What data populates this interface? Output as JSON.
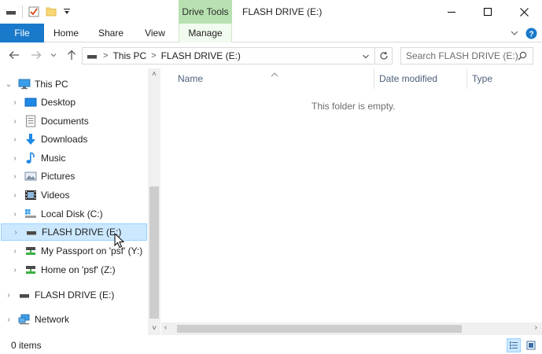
{
  "titlebar": {
    "drive_tools": "Drive Tools",
    "title": "FLASH DRIVE (E:)"
  },
  "ribbon": {
    "tabs": [
      "File",
      "Home",
      "Share",
      "View",
      "Manage"
    ]
  },
  "address": {
    "crumbs": [
      "This PC",
      "FLASH DRIVE (E:)"
    ],
    "search_placeholder": "Search FLASH DRIVE (E:)"
  },
  "nav": {
    "this_pc": "This PC",
    "items": [
      {
        "label": "Desktop",
        "icon": "desktop-icon"
      },
      {
        "label": "Documents",
        "icon": "documents-icon"
      },
      {
        "label": "Downloads",
        "icon": "downloads-icon"
      },
      {
        "label": "Music",
        "icon": "music-icon"
      },
      {
        "label": "Pictures",
        "icon": "pictures-icon"
      },
      {
        "label": "Videos",
        "icon": "videos-icon"
      },
      {
        "label": "Local Disk (C:)",
        "icon": "local-disk-icon"
      },
      {
        "label": "FLASH DRIVE (E:)",
        "icon": "usb-drive-icon"
      },
      {
        "label": "My Passport on 'psf' (Y:)",
        "icon": "network-drive-icon"
      },
      {
        "label": "Home on 'psf' (Z:)",
        "icon": "network-drive-icon"
      }
    ],
    "flash_drive": "FLASH DRIVE (E:)",
    "network": "Network"
  },
  "content": {
    "columns": [
      "Name",
      "Date modified",
      "Type"
    ],
    "empty_message": "This folder is empty."
  },
  "status": {
    "items": "0 items"
  },
  "colors": {
    "file_tab": "#1979ca",
    "drive_tools": "#b7e1b0",
    "selection": "#cce8ff"
  }
}
